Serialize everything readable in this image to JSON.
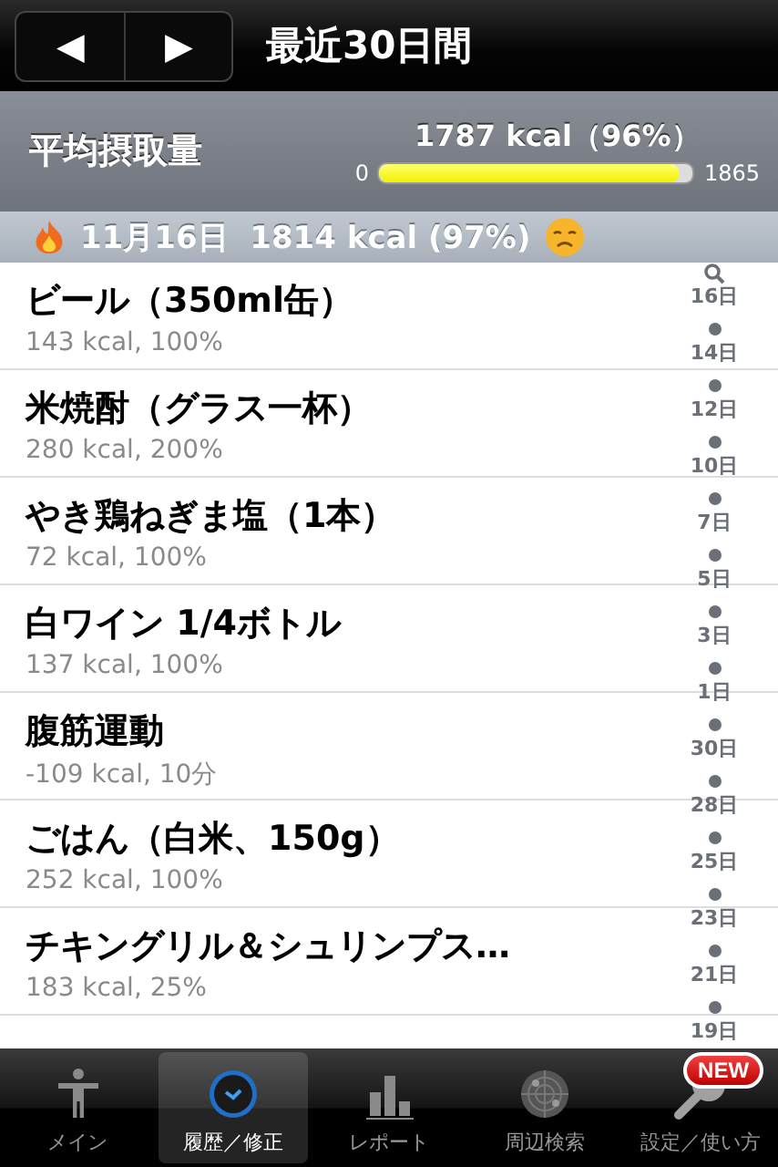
{
  "nav": {
    "prev": "◀",
    "next": "▶",
    "title": "最近30日間"
  },
  "summary": {
    "label": "平均摂取量",
    "value": "1787 kcal（96%）",
    "min": "0",
    "max": "1865",
    "level": 0.958
  },
  "day_header": {
    "text": "11月16日  1814 kcal (97%)"
  },
  "entries": [
    {
      "name": "ビール（350ml缶）",
      "detail": "143 kcal, 100%"
    },
    {
      "name": "米焼酎（グラス一杯）",
      "detail": "280 kcal, 200%"
    },
    {
      "name": "やき鶏ねぎま塩（1本）",
      "detail": "72 kcal, 100%"
    },
    {
      "name": "白ワイン 1/4ボトル",
      "detail": "137 kcal, 100%"
    },
    {
      "name": "腹筋運動",
      "detail": "-109 kcal, 10分"
    },
    {
      "name": "ごはん（白米、150g）",
      "detail": "252 kcal, 100%"
    },
    {
      "name": "チキングリル＆シュリンプス…",
      "detail": "183 kcal, 25%"
    }
  ],
  "index": [
    "16日",
    "14日",
    "12日",
    "10日",
    "7日",
    "5日",
    "3日",
    "1日",
    "30日",
    "28日",
    "25日",
    "23日",
    "21日",
    "19日"
  ],
  "tabs": [
    {
      "label": "メイン",
      "selected": false
    },
    {
      "label": "履歴／修正",
      "selected": true
    },
    {
      "label": "レポート",
      "selected": false
    },
    {
      "label": "周辺検索",
      "selected": false
    },
    {
      "label": "設定／使い方",
      "selected": false,
      "badge": "NEW"
    }
  ]
}
